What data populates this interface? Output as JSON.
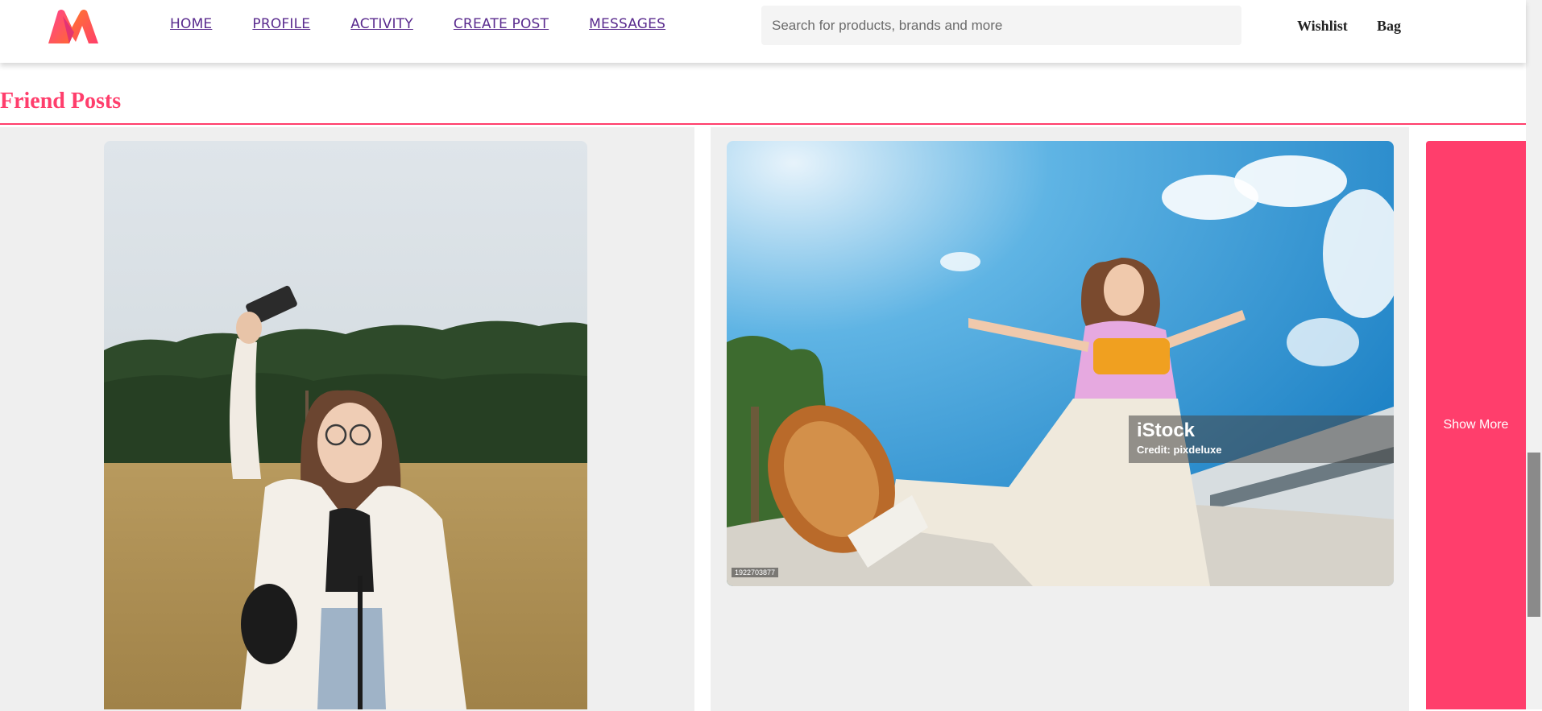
{
  "nav": {
    "items": [
      "HOME",
      "PROFILE",
      "ACTIVITY",
      "CREATE POST",
      "MESSAGES"
    ]
  },
  "search": {
    "placeholder": "Search for products, brands and more",
    "value": ""
  },
  "header_links": {
    "wishlist": "Wishlist",
    "bag": "Bag"
  },
  "section": {
    "title": "Friend Posts"
  },
  "posts": [
    {
      "image": "woman-taking-selfie-in-field"
    },
    {
      "image": "woman-kicking-at-skatepark",
      "watermark_brand": "iStock",
      "watermark_credit": "Credit: pixdeluxe",
      "image_id": "1922703877"
    }
  ],
  "show_more_label": "Show More",
  "colors": {
    "accent": "#ff3e6c",
    "nav_link": "#5a2b8e",
    "card_bg": "#efefef"
  },
  "icons": {
    "logo": "myntra-m-logo"
  }
}
